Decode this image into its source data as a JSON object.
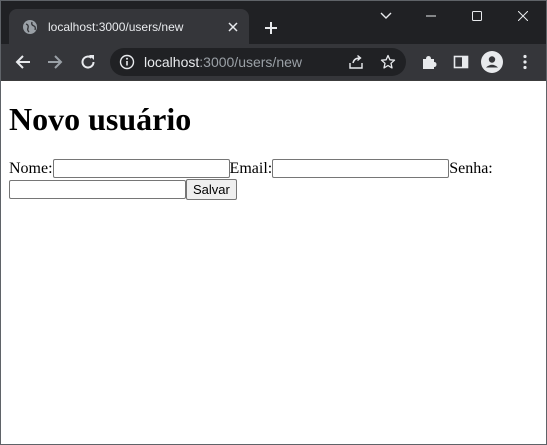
{
  "browser": {
    "tab": {
      "title": "localhost:3000/users/new",
      "icon": "globe-icon"
    },
    "omnibox": {
      "host": "localhost",
      "path": ":3000/users/new"
    },
    "colors": {
      "frame": "#202124",
      "toolbar": "#35363a",
      "text": "#e8eaed",
      "muted": "#9aa0a6"
    }
  },
  "page": {
    "heading": "Novo usuário",
    "form": {
      "name_label": "Nome:",
      "name_value": "",
      "email_label": "Email:",
      "email_value": "",
      "password_label": "Senha:",
      "password_value": "",
      "submit_label": "Salvar"
    }
  }
}
